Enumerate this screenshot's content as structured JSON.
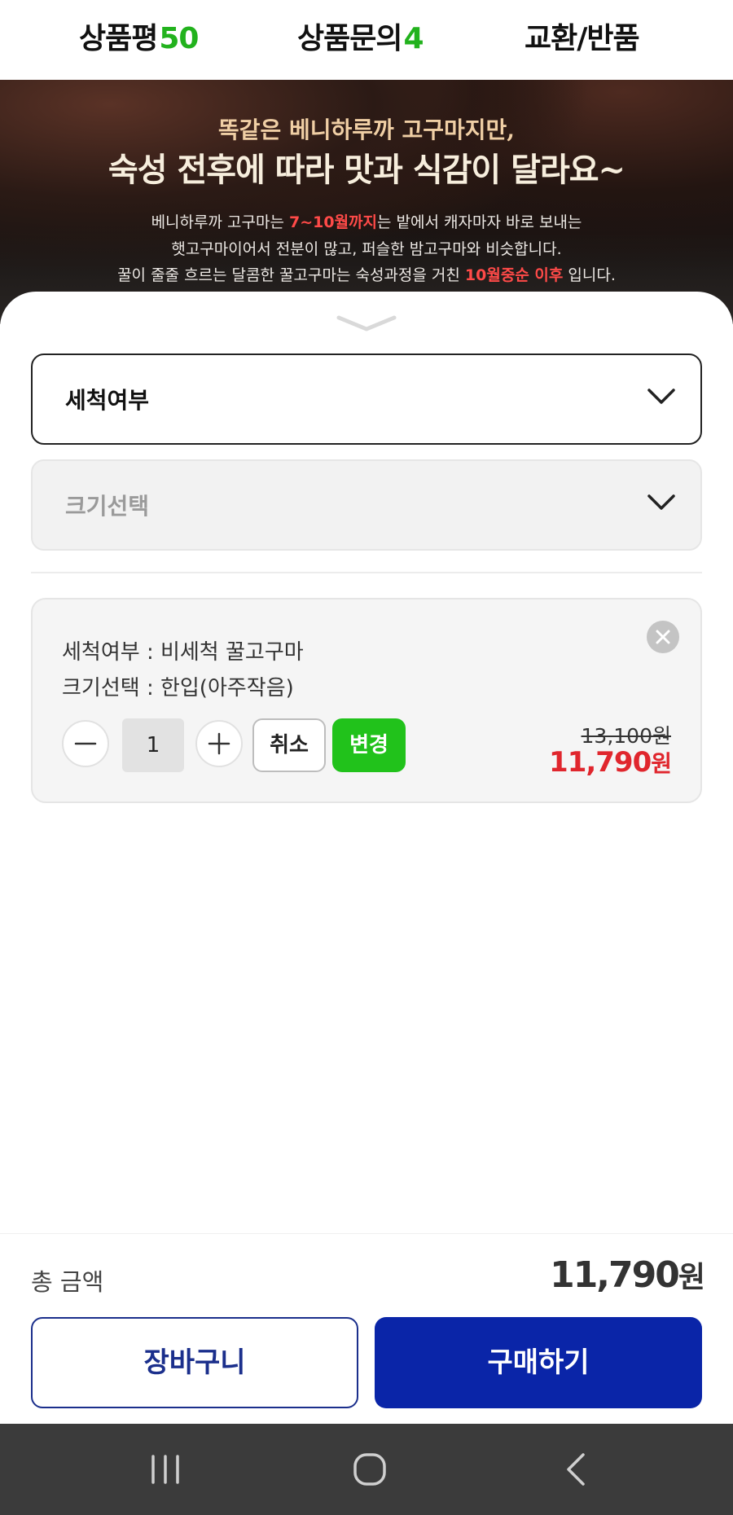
{
  "tabs": {
    "review_label": "상품평",
    "review_count": "50",
    "inquiry_label": "상품문의",
    "inquiry_count": "4",
    "return_label": "교환/반품"
  },
  "banner": {
    "line1": "똑같은 베니하루까 고구마지만,",
    "line2": "숙성 전후에 따라 맛과 식감이 달라요~",
    "desc1_pre": "베니하루까 고구마는 ",
    "desc1_hl": "7~10월까지",
    "desc1_post": "는 밭에서 캐자마자 바로 보내는",
    "desc2": "햇고구마이어서 전분이 많고, 퍼슬한 밤고구마와 비슷합니다.",
    "desc3_pre": "꿀이 줄줄 흐르는 달콤한 꿀고구마는 숙성과정을 거친 ",
    "desc3_hl": "10월중순 이후",
    "desc3_post": " 입니다."
  },
  "options": {
    "wash_select": "세척여부",
    "size_select": "크기선택"
  },
  "selected": {
    "line1": "세척여부 : 비세척 꿀고구마",
    "line2": "크기선택 : 한입(아주작음)",
    "quantity": "1",
    "cancel_label": "취소",
    "change_label": "변경",
    "original_price": "13,100원",
    "sale_price_number": "11,790",
    "sale_price_unit": "원"
  },
  "footer": {
    "total_label": "총 금액",
    "total_number": "11,790",
    "total_unit": "원",
    "cart_label": "장바구니",
    "buy_label": "구매하기"
  },
  "colors": {
    "accent_green": "#21c21b",
    "sale_red": "#e0262d",
    "buy_blue": "#0a25a8"
  }
}
